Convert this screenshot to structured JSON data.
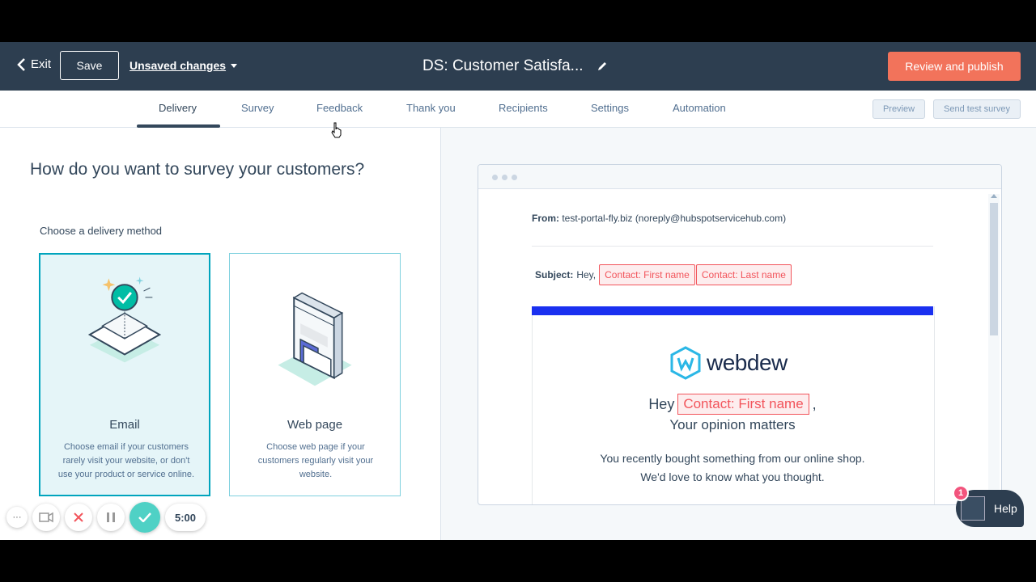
{
  "header": {
    "exit_label": "Exit",
    "save_label": "Save",
    "unsaved_label": "Unsaved changes",
    "title": "DS: Customer Satisfa...",
    "publish_label": "Review and publish"
  },
  "tabs": [
    {
      "label": "Delivery"
    },
    {
      "label": "Survey"
    },
    {
      "label": "Feedback"
    },
    {
      "label": "Thank you"
    },
    {
      "label": "Recipients"
    },
    {
      "label": "Settings"
    },
    {
      "label": "Automation"
    }
  ],
  "tab_actions": {
    "preview_label": "Preview",
    "send_test_label": "Send test survey"
  },
  "left": {
    "heading": "How do you want to survey your customers?",
    "subheading": "Choose a delivery method",
    "cards": [
      {
        "title": "Email",
        "description": "Choose email if your customers rarely visit your website, or don't use your product or service online.",
        "selected": true
      },
      {
        "title": "Web page",
        "description": "Choose web page if your customers regularly visit your website.",
        "selected": false
      }
    ]
  },
  "preview": {
    "from_label": "From:",
    "from_value": "test-portal-fly.biz (noreply@hubspotservicehub.com)",
    "subject_label": "Subject:",
    "subject_prefix": "Hey,",
    "subject_token_1": "Contact: First name",
    "subject_token_2": "Contact: Last name",
    "logo_text": "webdew",
    "hey_text": "Hey",
    "hey_token": "Contact: First name",
    "hey_suffix": ",",
    "opinion_text": "Your opinion matters",
    "body_text": "You recently bought something from our online shop. We'd love to know what you thought.",
    "band_color": "#1a30f0"
  },
  "recorder": {
    "more_icon": "···",
    "timer": "5:00"
  },
  "help": {
    "label": "Help",
    "badge": "1"
  },
  "colors": {
    "header_bg": "#2d3e50",
    "accent": "#f2735b",
    "token": "#f2545b",
    "selected_border": "#00a4bd"
  }
}
